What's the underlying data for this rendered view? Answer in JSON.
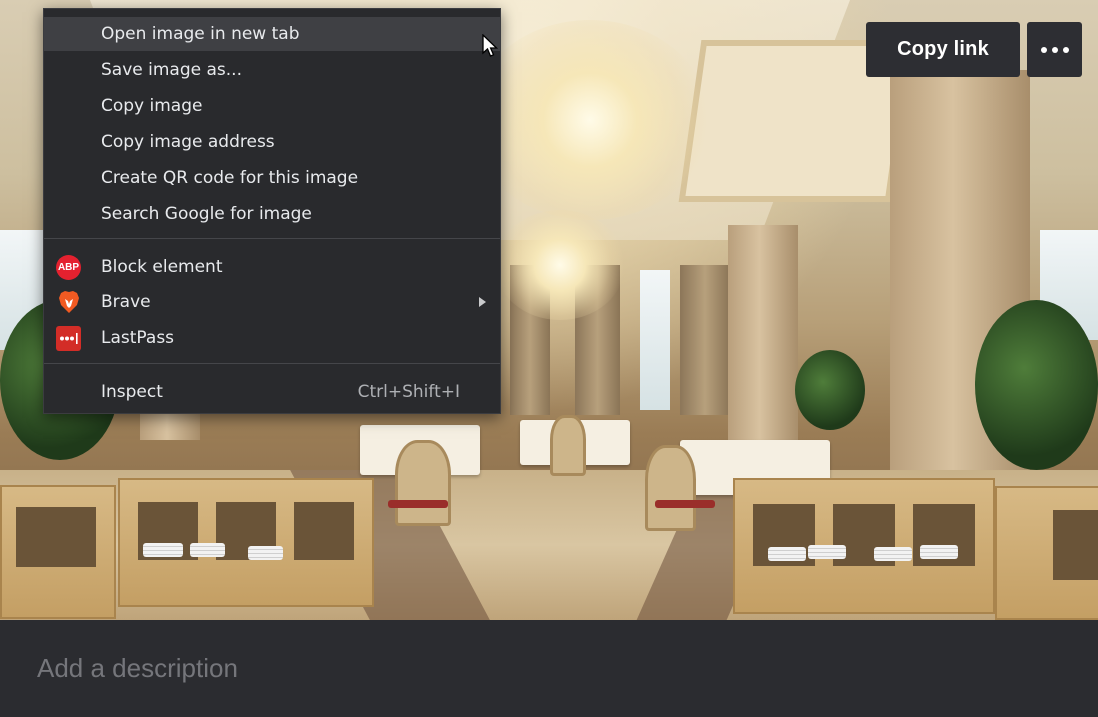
{
  "toolbar": {
    "copy_link_label": "Copy link",
    "more_icon": "ellipsis-horizontal-icon"
  },
  "description": {
    "placeholder": "Add a description",
    "value": ""
  },
  "context_menu": {
    "items": [
      {
        "label": "Open image in new tab",
        "state": "hovered"
      },
      {
        "label": "Save image as..."
      },
      {
        "label": "Copy image"
      },
      {
        "label": "Copy image address"
      },
      {
        "label": "Create QR code for this image"
      },
      {
        "label": "Search Google for image"
      },
      {
        "label": "Block element",
        "icon": "adblock-plus-icon",
        "icon_text": "ABP"
      },
      {
        "label": "Brave",
        "icon": "brave-lion-icon",
        "has_submenu": true
      },
      {
        "label": "LastPass",
        "icon": "lastpass-icon"
      },
      {
        "label": "Inspect",
        "shortcut": "Ctrl+Shift+I"
      }
    ]
  },
  "colors": {
    "menu_background": "#292a2d",
    "menu_hover": "#3f4044",
    "button_background": "#2d2e33",
    "description_bar": "#2b2c30",
    "abp_red": "#e4212f",
    "brave_orange": "#f15a22",
    "lastpass_red": "#d32d27"
  }
}
